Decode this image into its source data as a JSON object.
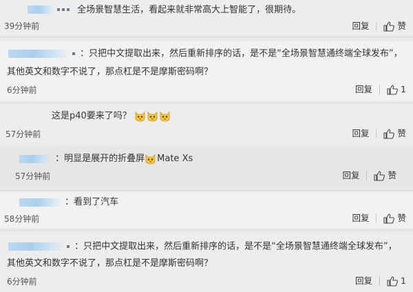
{
  "comments": [
    {
      "text": "全场景智慧生活，看起来就非常高大上智能了，很期待。",
      "time": "39分钟前",
      "reply_label": "回复",
      "like_label": "赞",
      "like_count": ""
    },
    {
      "text_line1": "：只把中文提取出来，然后重新排序的话，是不是“全场景智慧通终端全球发布”，",
      "text_line2": "其他英文和数字不说了，那点杠是不是摩斯密码啊？",
      "time": "6分钟前",
      "reply_label": "回复",
      "like_label": "",
      "like_count": "1"
    },
    {
      "text": "这是p40要来了吗？",
      "time": "57分钟前",
      "reply_label": "回复",
      "like_label": "赞",
      "like_count": ""
    },
    {
      "text_before": "：明显是展开的折叠屏",
      "text_after": "Mate Xs",
      "time": "57分钟前",
      "reply_label": "回复",
      "like_label": "赞",
      "like_count": ""
    },
    {
      "text": "：看到了汽车",
      "time": "58分钟前",
      "reply_label": "回复",
      "like_label": "赞",
      "like_count": ""
    },
    {
      "text_line1": "：只把中文提取出来，然后重新排序的话，是不是“全场景智慧通终端全球发布”，",
      "text_line2": "其他英文和数字不说了，那点杠是不是摩斯密码啊？",
      "time": "6分钟前",
      "reply_label": "回复",
      "like_label": "",
      "like_count": "1"
    }
  ],
  "icons": {
    "thumb": "thumbs-up-icon",
    "emoji": "cat-face-emoji-icon"
  },
  "colors": {
    "background": "#ededed",
    "text": "#333333",
    "avatar_blur": "#a9cfee"
  }
}
